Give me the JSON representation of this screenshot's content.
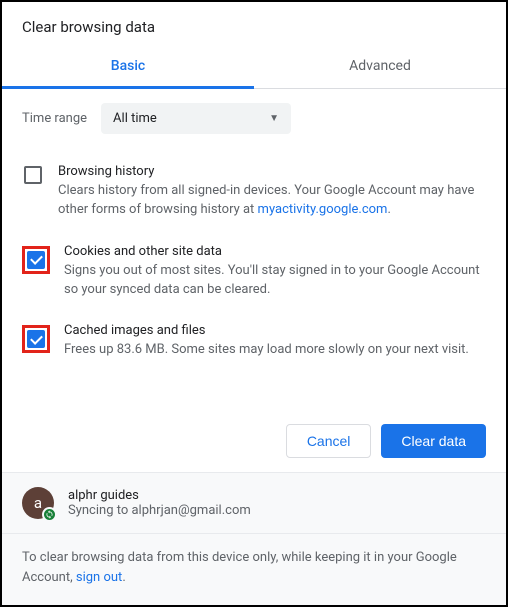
{
  "dialog": {
    "title": "Clear browsing data"
  },
  "tabs": {
    "basic": "Basic",
    "advanced": "Advanced"
  },
  "time": {
    "label": "Time range",
    "value": "All time"
  },
  "options": {
    "history": {
      "title": "Browsing history",
      "desc_pre": "Clears history from all signed-in devices. Your Google Account may have other forms of browsing history at ",
      "link": "myactivity.google.com",
      "desc_post": "."
    },
    "cookies": {
      "title": "Cookies and other site data",
      "desc": "Signs you out of most sites. You'll stay signed in to your Google Account so your synced data can be cleared."
    },
    "cache": {
      "title": "Cached images and files",
      "desc": "Frees up 83.6 MB. Some sites may load more slowly on your next visit."
    }
  },
  "buttons": {
    "cancel": "Cancel",
    "clear": "Clear data"
  },
  "profile": {
    "initial": "a",
    "name": "alphr guides",
    "sync": "Syncing to alphrjan@gmail.com"
  },
  "footer": {
    "text_pre": "To clear browsing data from this device only, while keeping it in your Google Account, ",
    "signout": "sign out",
    "text_post": "."
  }
}
